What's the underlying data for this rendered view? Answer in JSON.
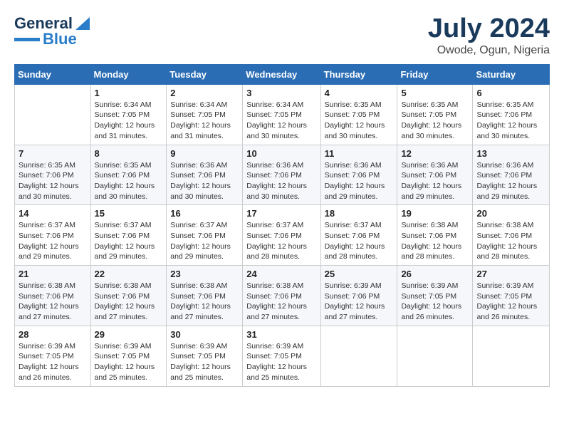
{
  "header": {
    "logo_line1": "General",
    "logo_line2": "Blue",
    "month_title": "July 2024",
    "location": "Owode, Ogun, Nigeria"
  },
  "weekdays": [
    "Sunday",
    "Monday",
    "Tuesday",
    "Wednesday",
    "Thursday",
    "Friday",
    "Saturday"
  ],
  "weeks": [
    [
      {
        "day": "",
        "sunrise": "",
        "sunset": "",
        "daylight": ""
      },
      {
        "day": "1",
        "sunrise": "Sunrise: 6:34 AM",
        "sunset": "Sunset: 7:05 PM",
        "daylight": "Daylight: 12 hours and 31 minutes."
      },
      {
        "day": "2",
        "sunrise": "Sunrise: 6:34 AM",
        "sunset": "Sunset: 7:05 PM",
        "daylight": "Daylight: 12 hours and 31 minutes."
      },
      {
        "day": "3",
        "sunrise": "Sunrise: 6:34 AM",
        "sunset": "Sunset: 7:05 PM",
        "daylight": "Daylight: 12 hours and 30 minutes."
      },
      {
        "day": "4",
        "sunrise": "Sunrise: 6:35 AM",
        "sunset": "Sunset: 7:05 PM",
        "daylight": "Daylight: 12 hours and 30 minutes."
      },
      {
        "day": "5",
        "sunrise": "Sunrise: 6:35 AM",
        "sunset": "Sunset: 7:05 PM",
        "daylight": "Daylight: 12 hours and 30 minutes."
      },
      {
        "day": "6",
        "sunrise": "Sunrise: 6:35 AM",
        "sunset": "Sunset: 7:06 PM",
        "daylight": "Daylight: 12 hours and 30 minutes."
      }
    ],
    [
      {
        "day": "7",
        "sunrise": "Sunrise: 6:35 AM",
        "sunset": "Sunset: 7:06 PM",
        "daylight": "Daylight: 12 hours and 30 minutes."
      },
      {
        "day": "8",
        "sunrise": "Sunrise: 6:35 AM",
        "sunset": "Sunset: 7:06 PM",
        "daylight": "Daylight: 12 hours and 30 minutes."
      },
      {
        "day": "9",
        "sunrise": "Sunrise: 6:36 AM",
        "sunset": "Sunset: 7:06 PM",
        "daylight": "Daylight: 12 hours and 30 minutes."
      },
      {
        "day": "10",
        "sunrise": "Sunrise: 6:36 AM",
        "sunset": "Sunset: 7:06 PM",
        "daylight": "Daylight: 12 hours and 30 minutes."
      },
      {
        "day": "11",
        "sunrise": "Sunrise: 6:36 AM",
        "sunset": "Sunset: 7:06 PM",
        "daylight": "Daylight: 12 hours and 29 minutes."
      },
      {
        "day": "12",
        "sunrise": "Sunrise: 6:36 AM",
        "sunset": "Sunset: 7:06 PM",
        "daylight": "Daylight: 12 hours and 29 minutes."
      },
      {
        "day": "13",
        "sunrise": "Sunrise: 6:36 AM",
        "sunset": "Sunset: 7:06 PM",
        "daylight": "Daylight: 12 hours and 29 minutes."
      }
    ],
    [
      {
        "day": "14",
        "sunrise": "Sunrise: 6:37 AM",
        "sunset": "Sunset: 7:06 PM",
        "daylight": "Daylight: 12 hours and 29 minutes."
      },
      {
        "day": "15",
        "sunrise": "Sunrise: 6:37 AM",
        "sunset": "Sunset: 7:06 PM",
        "daylight": "Daylight: 12 hours and 29 minutes."
      },
      {
        "day": "16",
        "sunrise": "Sunrise: 6:37 AM",
        "sunset": "Sunset: 7:06 PM",
        "daylight": "Daylight: 12 hours and 29 minutes."
      },
      {
        "day": "17",
        "sunrise": "Sunrise: 6:37 AM",
        "sunset": "Sunset: 7:06 PM",
        "daylight": "Daylight: 12 hours and 28 minutes."
      },
      {
        "day": "18",
        "sunrise": "Sunrise: 6:37 AM",
        "sunset": "Sunset: 7:06 PM",
        "daylight": "Daylight: 12 hours and 28 minutes."
      },
      {
        "day": "19",
        "sunrise": "Sunrise: 6:38 AM",
        "sunset": "Sunset: 7:06 PM",
        "daylight": "Daylight: 12 hours and 28 minutes."
      },
      {
        "day": "20",
        "sunrise": "Sunrise: 6:38 AM",
        "sunset": "Sunset: 7:06 PM",
        "daylight": "Daylight: 12 hours and 28 minutes."
      }
    ],
    [
      {
        "day": "21",
        "sunrise": "Sunrise: 6:38 AM",
        "sunset": "Sunset: 7:06 PM",
        "daylight": "Daylight: 12 hours and 27 minutes."
      },
      {
        "day": "22",
        "sunrise": "Sunrise: 6:38 AM",
        "sunset": "Sunset: 7:06 PM",
        "daylight": "Daylight: 12 hours and 27 minutes."
      },
      {
        "day": "23",
        "sunrise": "Sunrise: 6:38 AM",
        "sunset": "Sunset: 7:06 PM",
        "daylight": "Daylight: 12 hours and 27 minutes."
      },
      {
        "day": "24",
        "sunrise": "Sunrise: 6:38 AM",
        "sunset": "Sunset: 7:06 PM",
        "daylight": "Daylight: 12 hours and 27 minutes."
      },
      {
        "day": "25",
        "sunrise": "Sunrise: 6:39 AM",
        "sunset": "Sunset: 7:06 PM",
        "daylight": "Daylight: 12 hours and 27 minutes."
      },
      {
        "day": "26",
        "sunrise": "Sunrise: 6:39 AM",
        "sunset": "Sunset: 7:05 PM",
        "daylight": "Daylight: 12 hours and 26 minutes."
      },
      {
        "day": "27",
        "sunrise": "Sunrise: 6:39 AM",
        "sunset": "Sunset: 7:05 PM",
        "daylight": "Daylight: 12 hours and 26 minutes."
      }
    ],
    [
      {
        "day": "28",
        "sunrise": "Sunrise: 6:39 AM",
        "sunset": "Sunset: 7:05 PM",
        "daylight": "Daylight: 12 hours and 26 minutes."
      },
      {
        "day": "29",
        "sunrise": "Sunrise: 6:39 AM",
        "sunset": "Sunset: 7:05 PM",
        "daylight": "Daylight: 12 hours and 25 minutes."
      },
      {
        "day": "30",
        "sunrise": "Sunrise: 6:39 AM",
        "sunset": "Sunset: 7:05 PM",
        "daylight": "Daylight: 12 hours and 25 minutes."
      },
      {
        "day": "31",
        "sunrise": "Sunrise: 6:39 AM",
        "sunset": "Sunset: 7:05 PM",
        "daylight": "Daylight: 12 hours and 25 minutes."
      },
      {
        "day": "",
        "sunrise": "",
        "sunset": "",
        "daylight": ""
      },
      {
        "day": "",
        "sunrise": "",
        "sunset": "",
        "daylight": ""
      },
      {
        "day": "",
        "sunrise": "",
        "sunset": "",
        "daylight": ""
      }
    ]
  ]
}
